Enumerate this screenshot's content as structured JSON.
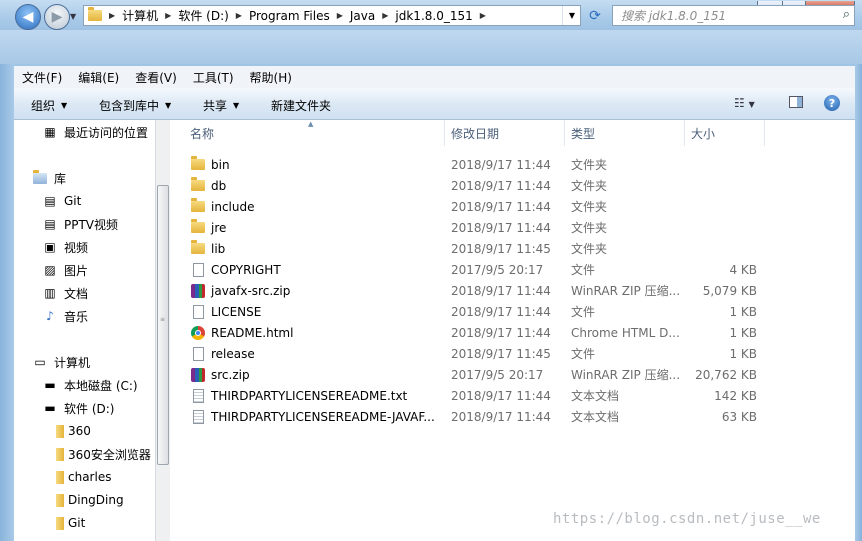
{
  "window": {
    "minimize": "─",
    "maximize": "□",
    "close": "✕"
  },
  "address": {
    "crumbs": [
      "计算机",
      "软件 (D:)",
      "Program Files",
      "Java",
      "jdk1.8.0_151"
    ],
    "search_placeholder": "搜索 jdk1.8.0_151"
  },
  "menu": [
    "文件(F)",
    "编辑(E)",
    "查看(V)",
    "工具(T)",
    "帮助(H)"
  ],
  "toolbar": {
    "organize": "组织",
    "include_library": "包含到库中",
    "share": "共享",
    "new_folder": "新建文件夹"
  },
  "nav": {
    "recent": "最近访问的位置",
    "libraries": "库",
    "lib_items": [
      "Git",
      "PPTV视频",
      "视频",
      "图片",
      "文档",
      "音乐"
    ],
    "computer": "计算机",
    "drive_c": "本地磁盘 (C:)",
    "drive_d": "软件 (D:)",
    "folders": [
      "360",
      "360安全浏览器",
      "charles",
      "DingDing",
      "Git"
    ]
  },
  "columns": {
    "name": "名称",
    "date": "修改日期",
    "type": "类型",
    "size": "大小"
  },
  "files": [
    {
      "name": "bin",
      "date": "2018/9/17 11:44",
      "type": "文件夹",
      "size": "",
      "icon": "folder-icon"
    },
    {
      "name": "db",
      "date": "2018/9/17 11:44",
      "type": "文件夹",
      "size": "",
      "icon": "folder-icon"
    },
    {
      "name": "include",
      "date": "2018/9/17 11:44",
      "type": "文件夹",
      "size": "",
      "icon": "folder-icon"
    },
    {
      "name": "jre",
      "date": "2018/9/17 11:44",
      "type": "文件夹",
      "size": "",
      "icon": "folder-icon"
    },
    {
      "name": "lib",
      "date": "2018/9/17 11:45",
      "type": "文件夹",
      "size": "",
      "icon": "folder-icon"
    },
    {
      "name": "COPYRIGHT",
      "date": "2017/9/5 20:17",
      "type": "文件",
      "size": "4 KB",
      "icon": "file-icon"
    },
    {
      "name": "javafx-src.zip",
      "date": "2018/9/17 11:44",
      "type": "WinRAR ZIP 压缩...",
      "size": "5,079 KB",
      "icon": "winrar-icon"
    },
    {
      "name": "LICENSE",
      "date": "2018/9/17 11:44",
      "type": "文件",
      "size": "1 KB",
      "icon": "file-icon"
    },
    {
      "name": "README.html",
      "date": "2018/9/17 11:44",
      "type": "Chrome HTML D...",
      "size": "1 KB",
      "icon": "chrome-icon"
    },
    {
      "name": "release",
      "date": "2018/9/17 11:45",
      "type": "文件",
      "size": "1 KB",
      "icon": "file-icon"
    },
    {
      "name": "src.zip",
      "date": "2017/9/5 20:17",
      "type": "WinRAR ZIP 压缩...",
      "size": "20,762 KB",
      "icon": "winrar-icon"
    },
    {
      "name": "THIRDPARTYLICENSEREADME.txt",
      "date": "2018/9/17 11:44",
      "type": "文本文档",
      "size": "142 KB",
      "icon": "text-file-icon"
    },
    {
      "name": "THIRDPARTYLICENSEREADME-JAVAF...",
      "date": "2018/9/17 11:44",
      "type": "文本文档",
      "size": "63 KB",
      "icon": "text-file-icon"
    }
  ],
  "watermark": "https://blog.csdn.net/juse__we"
}
